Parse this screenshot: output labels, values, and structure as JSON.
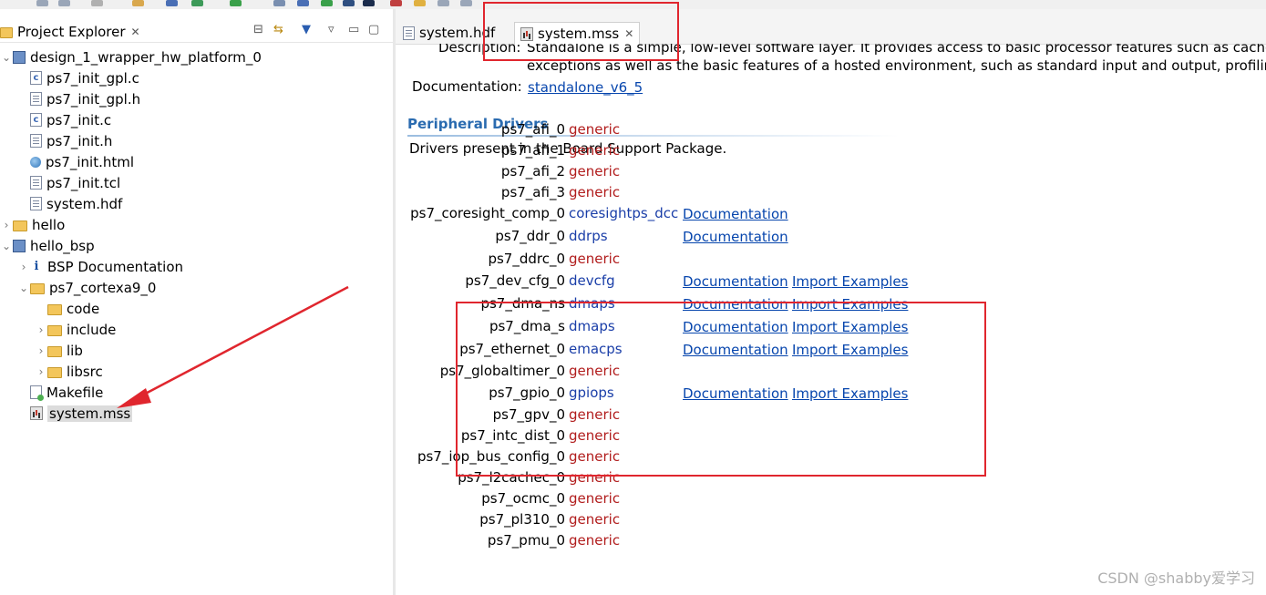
{
  "project_explorer": {
    "title": "Project Explorer",
    "tree": [
      {
        "label": "design_1_wrapper_hw_platform_0",
        "icon": "project-icon",
        "level": 0,
        "twisty": "expanded"
      },
      {
        "label": "ps7_init_gpl.c",
        "icon": "c-file-icon",
        "level": 1
      },
      {
        "label": "ps7_init_gpl.h",
        "icon": "h-file-icon",
        "level": 1
      },
      {
        "label": "ps7_init.c",
        "icon": "c-file-icon",
        "level": 1
      },
      {
        "label": "ps7_init.h",
        "icon": "h-file-icon",
        "level": 1
      },
      {
        "label": "ps7_init.html",
        "icon": "html-file-icon",
        "level": 1
      },
      {
        "label": "ps7_init.tcl",
        "icon": "file-icon",
        "level": 1
      },
      {
        "label": "system.hdf",
        "icon": "file-icon",
        "level": 1
      },
      {
        "label": "hello",
        "icon": "folder-icon",
        "level": 0,
        "twisty": "collapsed"
      },
      {
        "label": "hello_bsp",
        "icon": "project-icon",
        "level": 0,
        "twisty": "expanded"
      },
      {
        "label": "BSP Documentation",
        "icon": "info-icon",
        "level": 1,
        "twisty": "collapsed"
      },
      {
        "label": "ps7_cortexa9_0",
        "icon": "folder-icon",
        "level": 1,
        "twisty": "expanded"
      },
      {
        "label": "code",
        "icon": "folder-icon",
        "level": 2
      },
      {
        "label": "include",
        "icon": "folder-icon",
        "level": 2,
        "twisty": "collapsed"
      },
      {
        "label": "lib",
        "icon": "folder-icon",
        "level": 2,
        "twisty": "collapsed"
      },
      {
        "label": "libsrc",
        "icon": "folder-icon",
        "level": 2,
        "twisty": "collapsed"
      },
      {
        "label": "Makefile",
        "icon": "makefile-icon",
        "level": 1
      },
      {
        "label": "system.mss",
        "icon": "mss-file-icon",
        "level": 1,
        "selected": true
      }
    ]
  },
  "editor_tabs": [
    {
      "label": "system.hdf",
      "active": false
    },
    {
      "label": "system.mss",
      "active": true
    }
  ],
  "content": {
    "description_label": "Description:",
    "description_line1": "Standalone is a simple, low-level software layer. It provides access to basic processor features such as caches, in",
    "description_line2": "exceptions as well as the basic features of a hosted environment, such as standard input and output, profiling, ab",
    "documentation_label": "Documentation:",
    "documentation_link": "standalone_v6_5",
    "section_title": "Peripheral Drivers",
    "section_intro": "Drivers present in the Board Support Package.",
    "doc_link_label": "Documentation",
    "import_link_label": "Import Examples",
    "drivers": [
      {
        "name": "ps7_afi_0",
        "driver": "generic",
        "doc": false,
        "import": false
      },
      {
        "name": "ps7_afi_1",
        "driver": "generic",
        "doc": false,
        "import": false
      },
      {
        "name": "ps7_afi_2",
        "driver": "generic",
        "doc": false,
        "import": false
      },
      {
        "name": "ps7_afi_3",
        "driver": "generic",
        "doc": false,
        "import": false
      },
      {
        "name": "ps7_coresight_comp_0",
        "driver": "coresightps_dcc",
        "doc": true,
        "import": false
      },
      {
        "name": "ps7_ddr_0",
        "driver": "ddrps",
        "doc": true,
        "import": false
      },
      {
        "name": "ps7_ddrc_0",
        "driver": "generic",
        "doc": false,
        "import": false
      },
      {
        "name": "ps7_dev_cfg_0",
        "driver": "devcfg",
        "doc": true,
        "import": true
      },
      {
        "name": "ps7_dma_ns",
        "driver": "dmaps",
        "doc": true,
        "import": true
      },
      {
        "name": "ps7_dma_s",
        "driver": "dmaps",
        "doc": true,
        "import": true
      },
      {
        "name": "ps7_ethernet_0",
        "driver": "emacps",
        "doc": true,
        "import": true
      },
      {
        "name": "ps7_globaltimer_0",
        "driver": "generic",
        "doc": false,
        "import": false
      },
      {
        "name": "ps7_gpio_0",
        "driver": "gpiops",
        "doc": true,
        "import": true
      },
      {
        "name": "ps7_gpv_0",
        "driver": "generic",
        "doc": false,
        "import": false
      },
      {
        "name": "ps7_intc_dist_0",
        "driver": "generic",
        "doc": false,
        "import": false
      },
      {
        "name": "ps7_iop_bus_config_0",
        "driver": "generic",
        "doc": false,
        "import": false
      },
      {
        "name": "ps7_l2cachec_0",
        "driver": "generic",
        "doc": false,
        "import": false
      },
      {
        "name": "ps7_ocmc_0",
        "driver": "generic",
        "doc": false,
        "import": false
      },
      {
        "name": "ps7_pl310_0",
        "driver": "generic",
        "doc": false,
        "import": false
      },
      {
        "name": "ps7_pmu_0",
        "driver": "generic",
        "doc": false,
        "import": false
      }
    ]
  },
  "watermark": "CSDN @shabby爱学习",
  "colors": {
    "generic": "#b11c1c",
    "driver": "#1a3ea8",
    "link": "#0645ad",
    "annotation": "#e0262e"
  }
}
